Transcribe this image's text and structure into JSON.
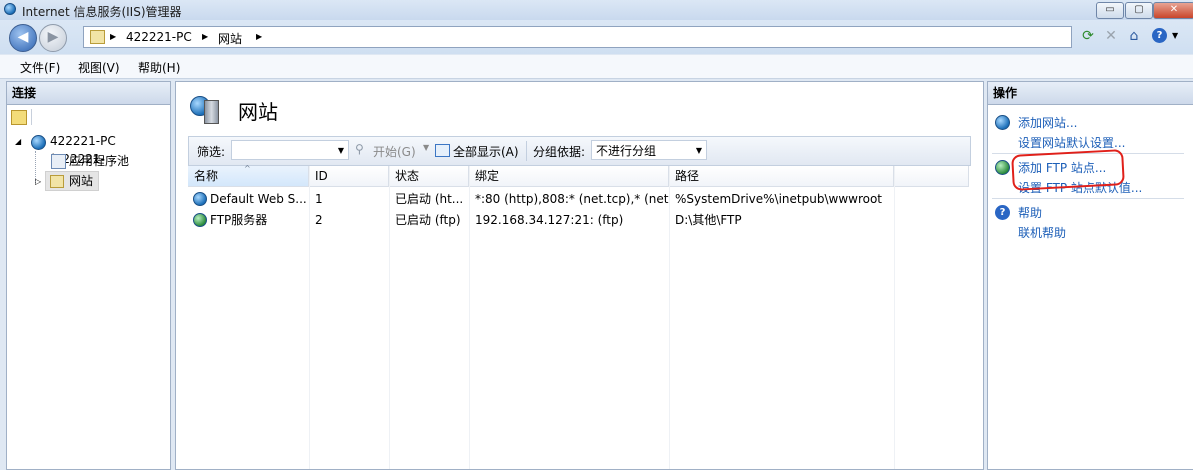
{
  "window": {
    "title": "Internet 信息服务(IIS)管理器"
  },
  "window_controls": {
    "minimize": "▭",
    "maximize": "▢",
    "close": "✕"
  },
  "breadcrumb": {
    "root": "422221-PC",
    "child": "网站"
  },
  "menu": [
    "文件(F)",
    "视图(V)",
    "帮助(H)"
  ],
  "connections": {
    "header": "连接",
    "tree": {
      "server": "422221-PC (422221-",
      "app_pools": "应用程序池",
      "sites": "网站"
    }
  },
  "main": {
    "title": "网站",
    "filter_label": "筛选:",
    "start_button": "开始(G)",
    "show_all_button": "全部显示(A)",
    "group_label": "分组依据:",
    "group_value": "不进行分组",
    "columns": [
      "名称",
      "ID",
      "状态",
      "绑定",
      "路径"
    ],
    "rows": [
      {
        "name": "Default Web S...",
        "id": "1",
        "status": "已启动 (ht...",
        "binding": "*:80 (http),808:* (net.tcp),* (net....",
        "path": "%SystemDrive%\\inetpub\\wwwroot"
      },
      {
        "name": "FTP服务器",
        "id": "2",
        "status": "已启动 (ftp)",
        "binding": "192.168.34.127:21: (ftp)",
        "path": "D:\\其他\\FTP"
      }
    ]
  },
  "actions": {
    "header": "操作",
    "add_site": "添加网站...",
    "site_defaults": "设置网站默认设置...",
    "add_ftp": "添加 FTP 站点...",
    "ftp_defaults": "设置 FTP 站点默认值...",
    "help": "帮助",
    "online_help": "联机帮助"
  },
  "colors": {
    "link": "#1d5fb8",
    "annotation": "#e0201a"
  }
}
